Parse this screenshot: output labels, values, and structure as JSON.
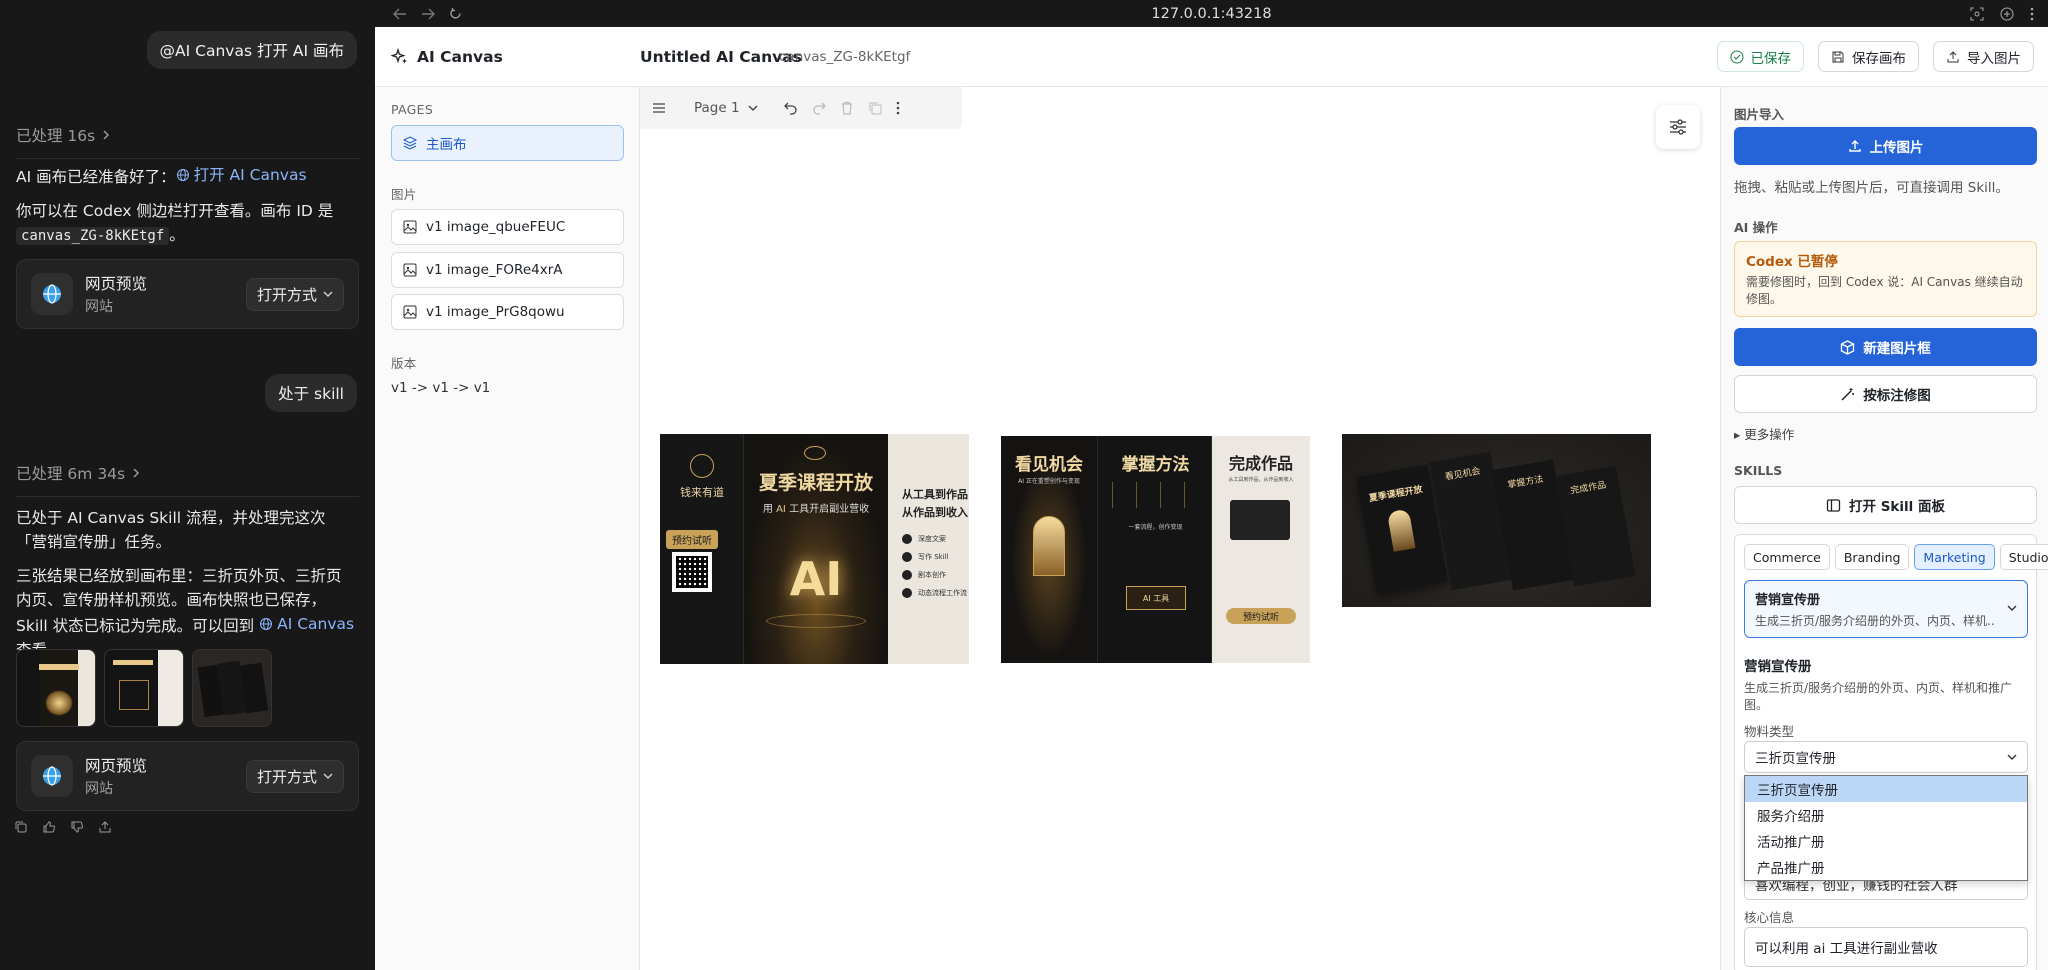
{
  "chat": {
    "user_msg_1": "@AI Canvas 打开 AI 画布",
    "processed_1": "已处理 16s",
    "reply_1_prefix": "AI 画布已经准备好了：",
    "reply_1_link": "打开 AI Canvas",
    "reply_1_line2": "你可以在 Codex 侧边栏打开查看。画布 ID 是",
    "reply_1_code": "canvas_ZG-8kKEtgf",
    "reply_1_end": "。",
    "preview_card": {
      "title": "网页预览",
      "subtitle": "网站",
      "open_label": "打开方式"
    },
    "user_msg_2": "处于 skill",
    "processed_2": "已处理 6m 34s",
    "reply_2_p1": "已处于 AI Canvas Skill 流程，并处理完这次「营销宣传册」任务。",
    "reply_2_p2": "三张结果已经放到画布里：三折页外页、三折页内页、宣传册样机预览。画布快照也已保存，Skill 状态已标记为完成。可以回到",
    "reply_2_link": "AI Canvas",
    "reply_2_end": "查看。"
  },
  "browser": {
    "url": "127.0.0.1:43218"
  },
  "header": {
    "brand": "AI Canvas",
    "doc_title": "Untitled AI Canvas",
    "doc_id": "canvas_ZG-8kKEtgf",
    "saved_label": "已保存",
    "save_canvas_label": "保存画布",
    "import_label": "导入图片"
  },
  "pages_panel": {
    "pages_heading": "PAGES",
    "main_page": "主画布",
    "images_heading": "图片",
    "images": [
      "v1 image_qbueFEUC",
      "v1 image_FORe4xrA",
      "v1 image_PrG8qowu"
    ],
    "version_heading": "版本",
    "version_text": "v1 -> v1 -> v1"
  },
  "canvas": {
    "page_label": "Page 1",
    "art1": {
      "brand": "钱来有道",
      "headline": "夏季课程开放",
      "sub_a": "用",
      "sub_b": "AI",
      "sub_c": "工具开启副业营收",
      "trial": "预约试听",
      "ai": "AI",
      "side_a": "从工具到作品",
      "side_b": "从作品到收入",
      "features": [
        "深度文案",
        "写作 Skill",
        "剧本创作",
        "动态流程工作流"
      ]
    },
    "art2": {
      "h1": "看见机会",
      "sub1": "AI 正在重塑创作与变现",
      "h2": "掌握方法",
      "sub2": "一套流程，创作变现",
      "h3": "完成作品",
      "sub3": "从工具到作品，从作品到收入",
      "trial": "预约试听",
      "box": "AI 工具"
    },
    "art3": {
      "headline": "夏季课程开放",
      "h1": "看见机会",
      "h2": "掌握方法",
      "h3": "完成作品"
    }
  },
  "right_panel": {
    "import_heading": "图片导入",
    "upload_label": "上传图片",
    "upload_hint": "拖拽、粘贴或上传图片后，可直接调用 Skill。",
    "ai_ops_heading": "AI 操作",
    "codex_paused_title": "Codex 已暂停",
    "codex_paused_desc": "需要修图时，回到 Codex 说：AI Canvas 继续自动修图。",
    "new_frame_label": "新建图片框",
    "annotate_label": "按标注修图",
    "more_ops": "更多操作",
    "skills_heading": "SKILLS",
    "open_skill_panel": "打开 Skill 面板",
    "tabs": [
      "Commerce",
      "Branding",
      "Marketing",
      "Studio"
    ],
    "active_tab": "Marketing",
    "skill_select_title": "营销宣传册",
    "skill_select_desc": "生成三折页/服务介绍册的外页、内页、样机...",
    "skill_title": "营销宣传册",
    "skill_desc": "生成三折页/服务介绍册的外页、内页、样机和推广图。",
    "material_label": "物料类型",
    "material_value": "三折页宣传册",
    "material_options": [
      "三折页宣传册",
      "服务介绍册",
      "活动推广册",
      "产品推广册"
    ],
    "audience_value": "喜欢编程，创业，赚钱的社会人群",
    "core_label": "核心信息",
    "core_value": "可以利用 ai 工具进行副业营收"
  },
  "colors": {
    "accent": "#2564d8",
    "gold": "#c9a25a",
    "dark": "#181818"
  }
}
